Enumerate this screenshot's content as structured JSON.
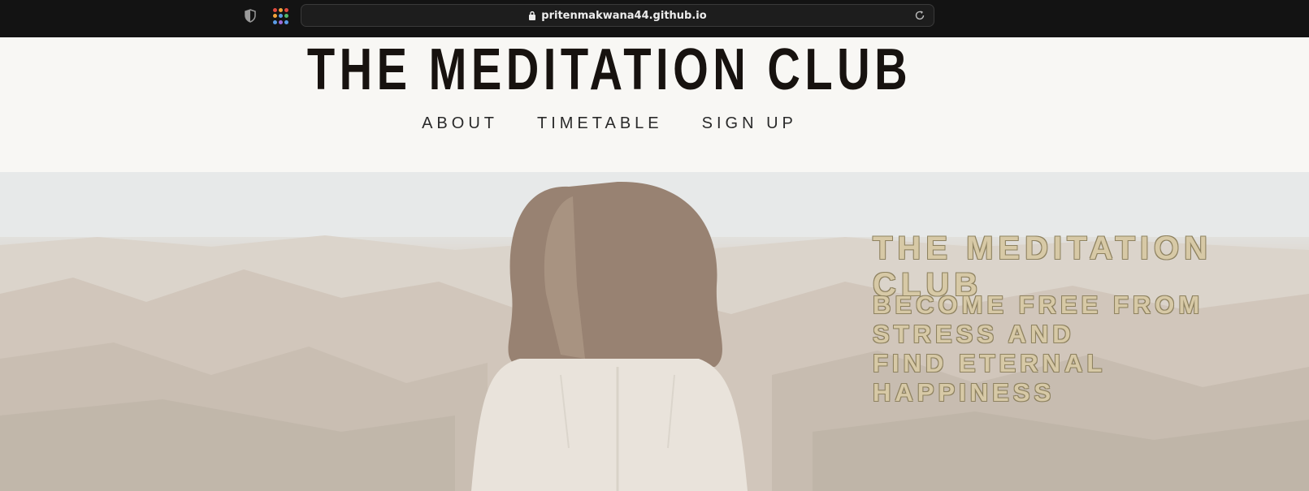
{
  "browser": {
    "url": "pritenmakwana44.github.io",
    "icons": [
      "shield-icon",
      "apps-grid-icon",
      "lock-icon",
      "reload-icon"
    ]
  },
  "header": {
    "title": "THE MEDITATION CLUB",
    "nav": [
      {
        "label": "ABOUT"
      },
      {
        "label": "TIMETABLE"
      },
      {
        "label": "SIGN UP"
      }
    ]
  },
  "hero": {
    "title": "THE MEDITATION CLUB",
    "subtitle_line1": "BECOME FREE FROM STRESS AND",
    "subtitle_line2": "FIND ETERNAL HAPPINESS"
  },
  "colors": {
    "browser_bar": "#131313",
    "header_bg": "#f8f7f4",
    "title_text": "#17120f",
    "hero_text": "#d7c9a6"
  }
}
